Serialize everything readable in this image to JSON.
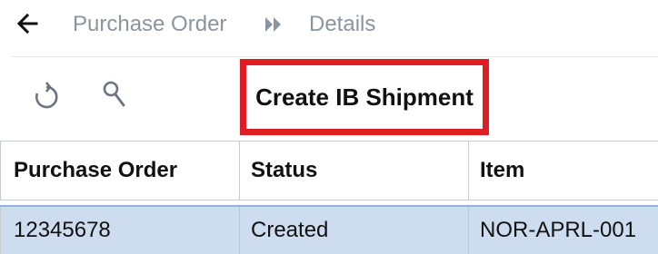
{
  "breadcrumb": {
    "back_icon": "arrow-left-icon",
    "items": [
      "Purchase Order",
      "Details"
    ],
    "separator_icon": "double-chevron-right-icon"
  },
  "toolbar": {
    "refresh_icon": "refresh-icon",
    "search_icon": "search-icon",
    "create_ib_shipment_label": "Create IB Shipment",
    "highlight_color": "#e01c24"
  },
  "grid": {
    "columns": [
      "Purchase Order",
      "Status",
      "Item"
    ],
    "rows": [
      {
        "purchase_order": "12345678",
        "status": "Created",
        "item": "NOR-APRL-001",
        "selected": true
      }
    ],
    "selected_row_color": "#cddcee"
  }
}
